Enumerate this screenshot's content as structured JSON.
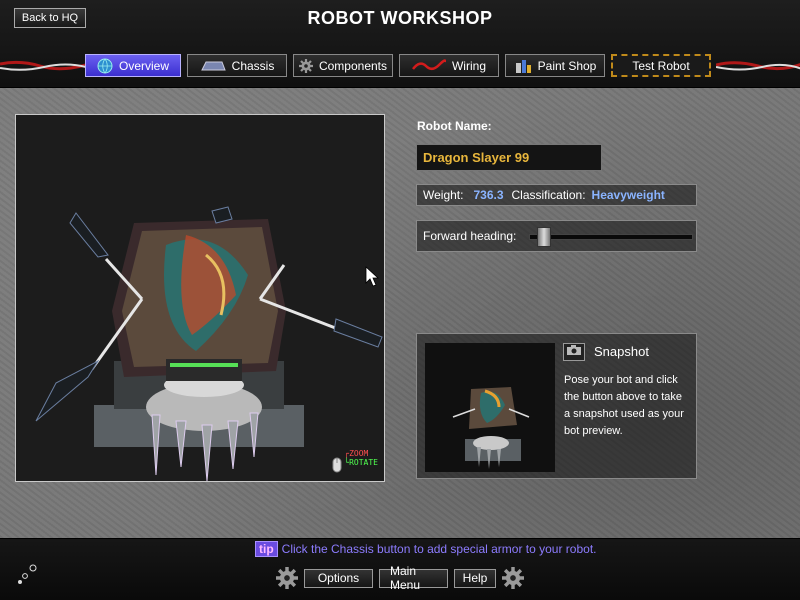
{
  "header": {
    "title": "ROBOT WORKSHOP",
    "back_label": "Back to HQ"
  },
  "tabs": [
    {
      "label": "Overview",
      "icon": "globe-icon",
      "active": true
    },
    {
      "label": "Chassis",
      "icon": "chassis-icon",
      "active": false
    },
    {
      "label": "Components",
      "icon": "gear-icon",
      "active": false
    },
    {
      "label": "Wiring",
      "icon": "wire-icon",
      "active": false
    },
    {
      "label": "Paint Shop",
      "icon": "paint-icon",
      "active": false
    },
    {
      "label": "Test Robot",
      "icon": "",
      "active": false
    }
  ],
  "viewport": {
    "zoom_label": "ZOOM",
    "rotate_label": "ROTATE"
  },
  "robot": {
    "name_label": "Robot Name:",
    "name_value": "Dragon Slayer 99",
    "weight_label": "Weight:",
    "weight_value": "736.3",
    "class_label": "Classification:",
    "class_value": "Heavyweight",
    "heading_label": "Forward heading:",
    "heading_position": 0.05
  },
  "snapshot": {
    "title": "Snapshot",
    "description": "Pose your bot and click the button above to take a snapshot used as your bot preview."
  },
  "tip": {
    "badge": "tip",
    "text": "Click the Chassis button to add special armor to your robot."
  },
  "footer": {
    "options_label": "Options",
    "main_menu_label": "Main Menu",
    "help_label": "Help"
  },
  "colors": {
    "accent": "#4a3ee0",
    "name_text": "#e8b63c",
    "value_text": "#8ab4ff",
    "tip_text": "#8d7cff"
  }
}
